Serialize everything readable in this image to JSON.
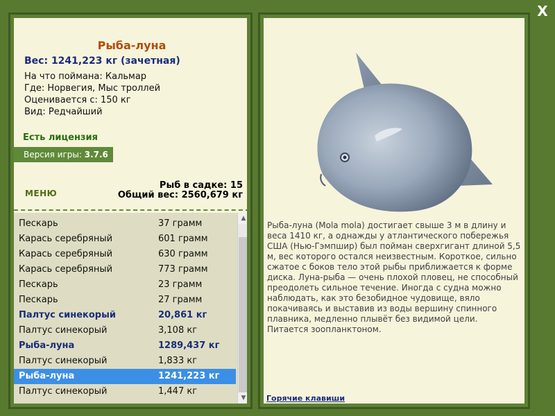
{
  "window": {
    "close_label": "X"
  },
  "details": {
    "name": "Рыба-луна",
    "weight": "Вес: 1241,223 кг (зачетная)",
    "bait": "На что поймана: Кальмар",
    "location": "Где: Норвегия, Мыс троллей",
    "valued": "Оценивается с: 150 кг",
    "rarity": "Вид: Редчайший",
    "license": "Есть лицензия",
    "version_label": "Версия игры:",
    "version_value": "3.7.6",
    "menu_label": "МЕНЮ",
    "cage_count": "Рыб в садке: 15",
    "total_weight": "Общий вес: 2560,679 кг"
  },
  "catch_list": [
    {
      "name": "Пескарь",
      "weight": "37 грамм",
      "style": "normal"
    },
    {
      "name": "Карась серебряный",
      "weight": "601 грамм",
      "style": "normal"
    },
    {
      "name": "Карась серебряный",
      "weight": "630 грамм",
      "style": "normal"
    },
    {
      "name": "Карась серебряный",
      "weight": "773 грамм",
      "style": "normal"
    },
    {
      "name": "Пескарь",
      "weight": "23 грамм",
      "style": "normal"
    },
    {
      "name": "Пескарь",
      "weight": "27 грамм",
      "style": "normal"
    },
    {
      "name": "Палтус синекорый",
      "weight": "20,861 кг",
      "style": "big"
    },
    {
      "name": "Палтус синекорый",
      "weight": "3,108 кг",
      "style": "normal"
    },
    {
      "name": "Рыба-луна",
      "weight": "1289,437 кг",
      "style": "big"
    },
    {
      "name": "Палтус синекорый",
      "weight": "1,833 кг",
      "style": "normal"
    },
    {
      "name": "Рыба-луна",
      "weight": "1241,223 кг",
      "style": "selected"
    },
    {
      "name": "Палтус синекорый",
      "weight": "1,447 кг",
      "style": "normal"
    }
  ],
  "scroll": {
    "up_icon": "▲",
    "down_icon": "▼"
  },
  "info_panel": {
    "description": "Рыба-луна (Mola mola) достигает свыше 3 м в длину и веса 1410 кг, а однажды у атлантического побережья США (Нью-Гэмпшир) был пойман сверхгигант длиной 5,5 м, вес которого остался неизвестным. Короткое, сильно сжатое с боков тело этой рыбы приближается к форме диска. Луна-рыба — очень плохой пловец, не способный преодолеть сильное течение. Иногда с судна можно наблюдать, как это безобидное чудовище, вяло покачиваясь и выставив из воды вершину спинного плавника, медленно плывёт без видимой цели. Питается зоопланктоном.",
    "hotkeys_label": "Горячие клавиши"
  },
  "colors": {
    "background": "#587a30",
    "panel": "#f7f4dc",
    "title": "#b14d0a",
    "accent_blue": "#1a2d7a",
    "license_green": "#2a6e10",
    "selection": "#3b8fe6"
  }
}
